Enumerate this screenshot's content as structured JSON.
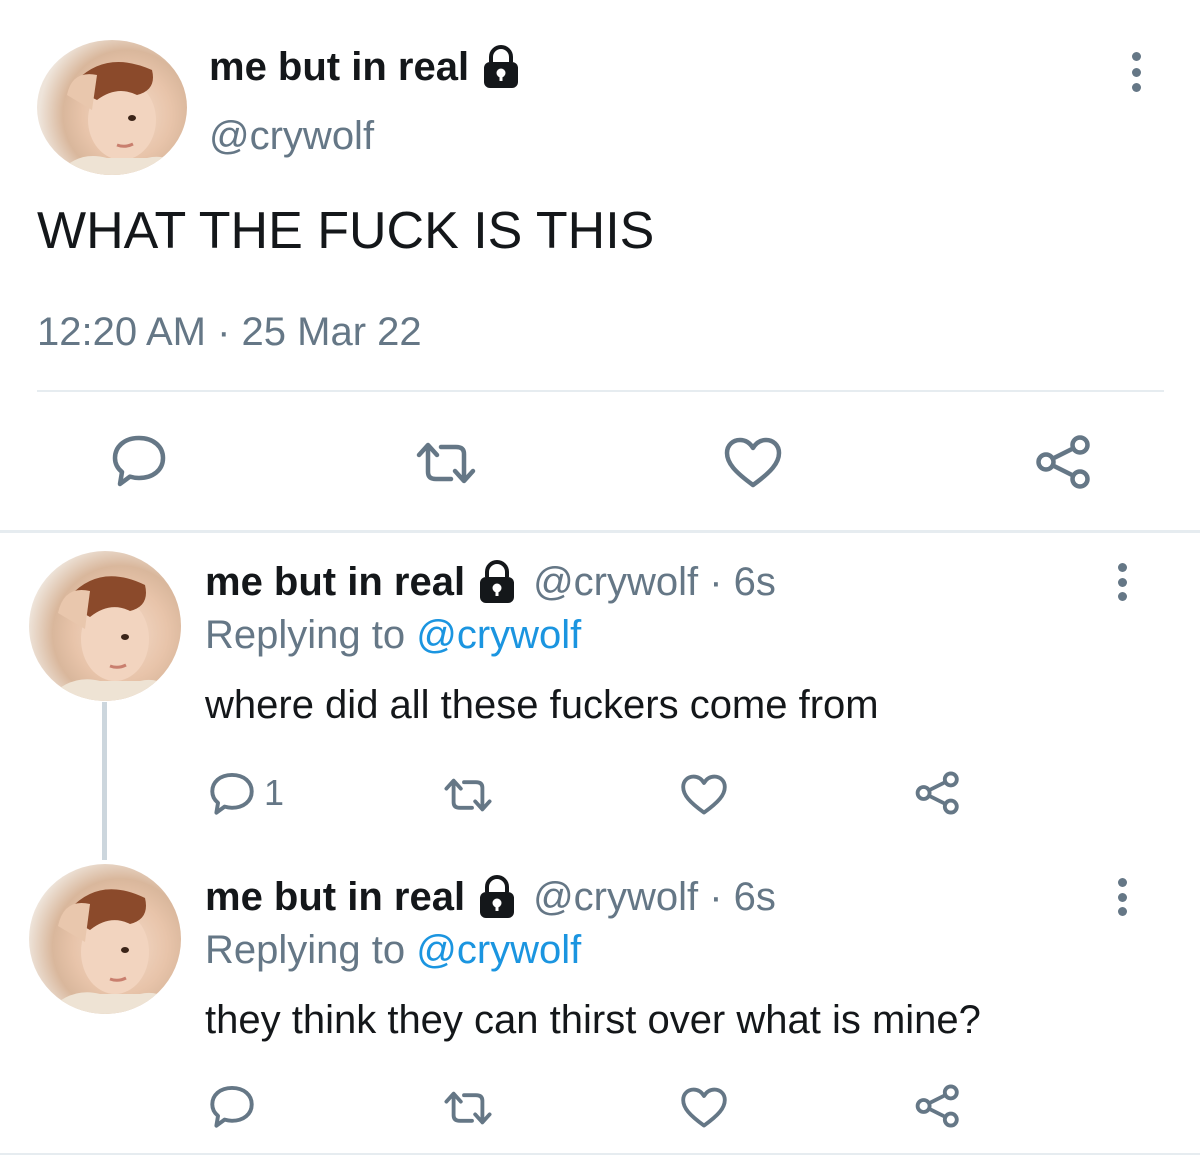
{
  "main_tweet": {
    "display_name": "me but in real",
    "handle": "@crywolf",
    "text": "WHAT THE FUCK IS THIS",
    "timestamp": "12:20 AM · 25 Mar 22"
  },
  "replies": [
    {
      "display_name": "me but in real",
      "meta": "@crywolf · 6s",
      "replying_prefix": "Replying to ",
      "replying_handle": "@crywolf",
      "text": "where did all these fuckers come from",
      "reply_count": "1"
    },
    {
      "display_name": "me but in real",
      "meta": "@crywolf · 6s",
      "replying_prefix": "Replying to ",
      "replying_handle": "@crywolf",
      "text": "they think they can thirst over what is mine?",
      "reply_count": ""
    }
  ],
  "icons": {
    "lock": "lock-icon",
    "reply": "reply-icon",
    "retweet": "retweet-icon",
    "like": "heart-icon",
    "share": "share-icon",
    "more": "more-options-icon"
  },
  "colors": {
    "text": "#14171a",
    "muted": "#657786",
    "link": "#1b95e0",
    "divider": "#e6ecf0"
  }
}
